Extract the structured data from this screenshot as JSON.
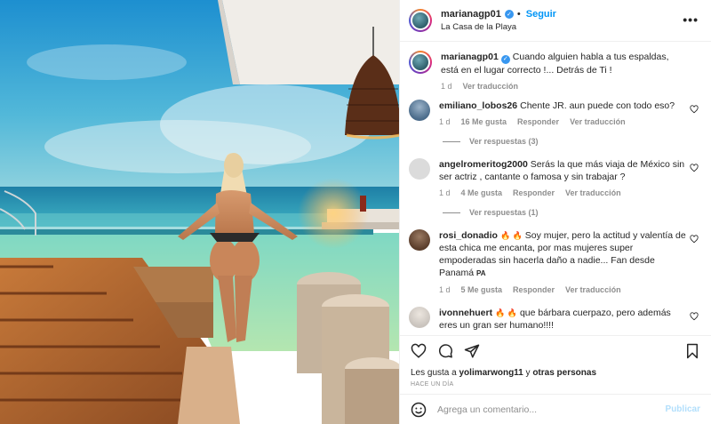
{
  "post": {
    "author": "marianagp01",
    "follow_label": "Seguir",
    "separator": "•",
    "location": "La Casa de la Playa",
    "more_label": "•••",
    "caption": "Cuando alguien habla a tus espaldas, está en el lugar correcto !... Detrás de Ti !",
    "caption_time": "1 d",
    "caption_translate": "Ver traducción"
  },
  "comments": [
    {
      "user": "emiliano_lobos26",
      "text": "Chente JR. aun puede con todo eso?",
      "time": "1 d",
      "likes": "16 Me gusta",
      "reply": "Responder",
      "translate": "Ver traducción",
      "replies": "Ver respuestas (3)",
      "avatar_color": "#4a6b8a"
    },
    {
      "user": "angelromeritog2000",
      "text": "Serás la que más viaja de México sin ser actriz , cantante o famosa y sin trabajar ?",
      "time": "1 d",
      "likes": "4 Me gusta",
      "reply": "Responder",
      "translate": "Ver traducción",
      "replies": "Ver respuestas (1)",
      "avatar_color": "#dbdbdb"
    },
    {
      "user": "rosi_donadio",
      "text_pre": "🔥 🔥",
      "text": "Soy mujer, pero la actitud y valentía de esta chica me encanta, por mas mujeres super empoderadas sin hacerla daño a nadie... Fan desde Panamá",
      "flag": "PA",
      "time": "1 d",
      "likes": "5 Me gusta",
      "reply": "Responder",
      "translate": "Ver traducción",
      "avatar_color": "#5a3d2b"
    },
    {
      "user": "ivonnehuert",
      "text_pre": "🔥 🔥",
      "text": "que bárbara cuerpazo, pero además eres un gran ser humano!!!!",
      "avatar_color": "#c9c3bd"
    }
  ],
  "actions": {
    "like_icon": "heart-icon",
    "comment_icon": "comment-icon",
    "share_icon": "share-icon",
    "save_icon": "bookmark-icon",
    "likes_prefix": "Les gusta a",
    "likes_user": "yolimarwong11",
    "likes_and": "y",
    "likes_others": "otras personas",
    "time_ago": "HACE UN DÍA"
  },
  "add_comment": {
    "placeholder": "Agrega un comentario...",
    "post_label": "Publicar"
  },
  "colors": {
    "accent": "#0095f6",
    "verified": "#3897f0",
    "muted": "#8e8e8e"
  }
}
